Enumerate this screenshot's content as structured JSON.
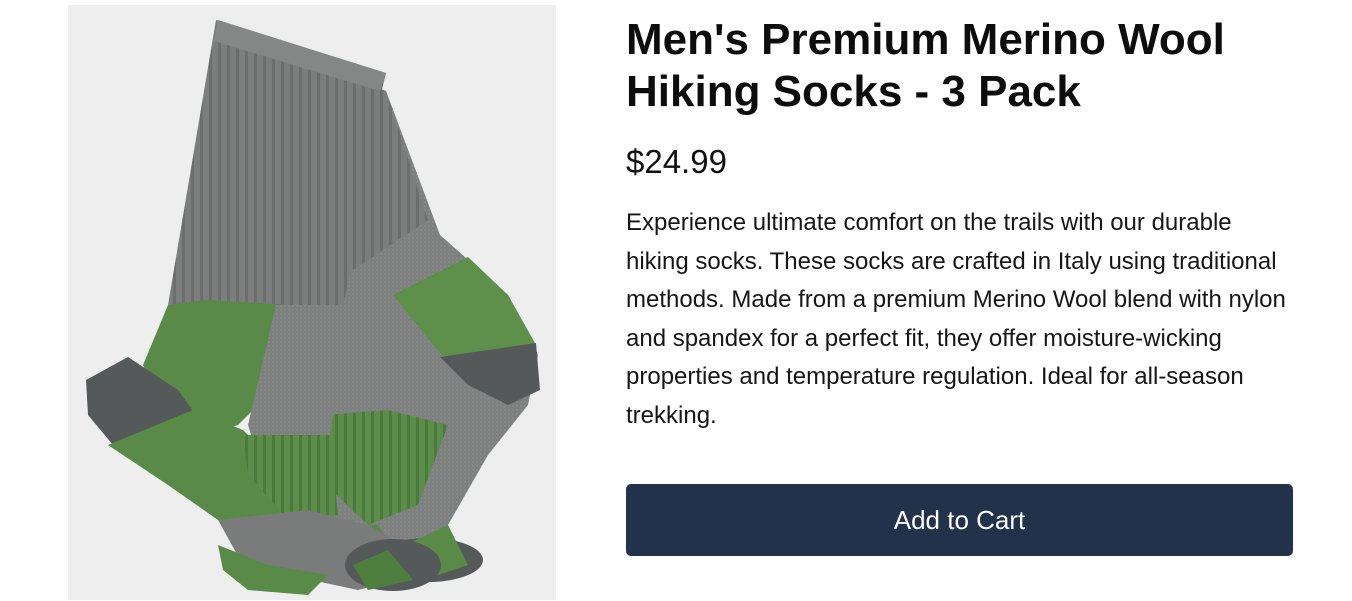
{
  "product": {
    "title": "Men's Premium Merino Wool Hiking Socks - 3 Pack",
    "price": "$24.99",
    "description": "Experience ultimate comfort on the trails with our durable hiking socks. These socks are crafted in Italy using traditional methods. Made from a premium Merino Wool blend with nylon and spandex for a perfect fit, they offer moisture-wicking properties and temperature regulation. Ideal for all-season trekking.",
    "image_alt": "Grey and green merino wool hiking socks"
  },
  "actions": {
    "add_to_cart_label": "Add to Cart"
  },
  "colors": {
    "button_bg": "#22324a",
    "sock_grey": "#7d7f7e",
    "sock_green": "#5a8a48",
    "sock_dark": "#55595a"
  }
}
